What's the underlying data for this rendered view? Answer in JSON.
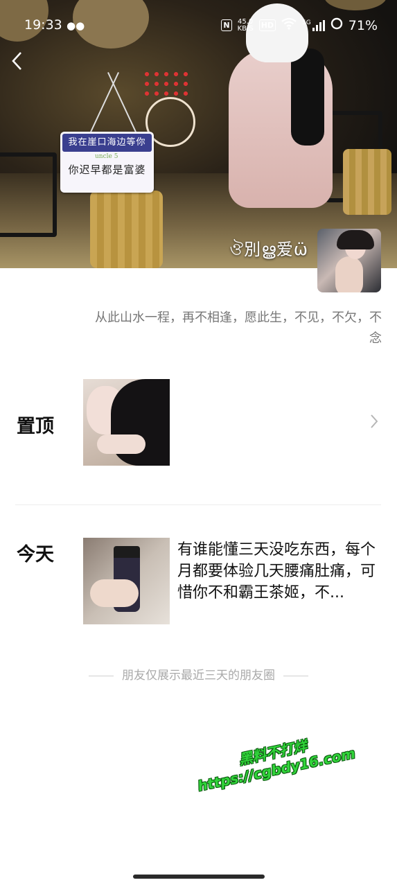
{
  "status_bar": {
    "time": "19:33",
    "speed_value": "45.0",
    "speed_unit": "KB/S",
    "hd_label": "HD",
    "network_label": "5G",
    "battery": "71%"
  },
  "cover": {
    "sign_top": "我在崖口海边等你",
    "sign_mid": "uncle 5",
    "sign_bottom": "你迟早都是富婆"
  },
  "profile": {
    "nickname": "ঔ別ൠ爱ω̈",
    "signature": "从此山水一程，再不相逢，愿此生，不见，不欠，不念"
  },
  "pinned": {
    "label": "置顶"
  },
  "today": {
    "label": "今天",
    "post_text": "有谁能懂三天没吃东西，每个月都要体验几天腰痛肚痛，可惜你不和霸王茶姬，不..."
  },
  "footer": {
    "note": "朋友仅展示最近三天的朋友圈"
  },
  "watermark": {
    "line1": "黑料不打烊",
    "line2": "https://cgbdy16.com"
  },
  "colors": {
    "accent_watermark": "#31d43a",
    "muted_text": "#767676",
    "footer_text": "#a9a9a9"
  }
}
